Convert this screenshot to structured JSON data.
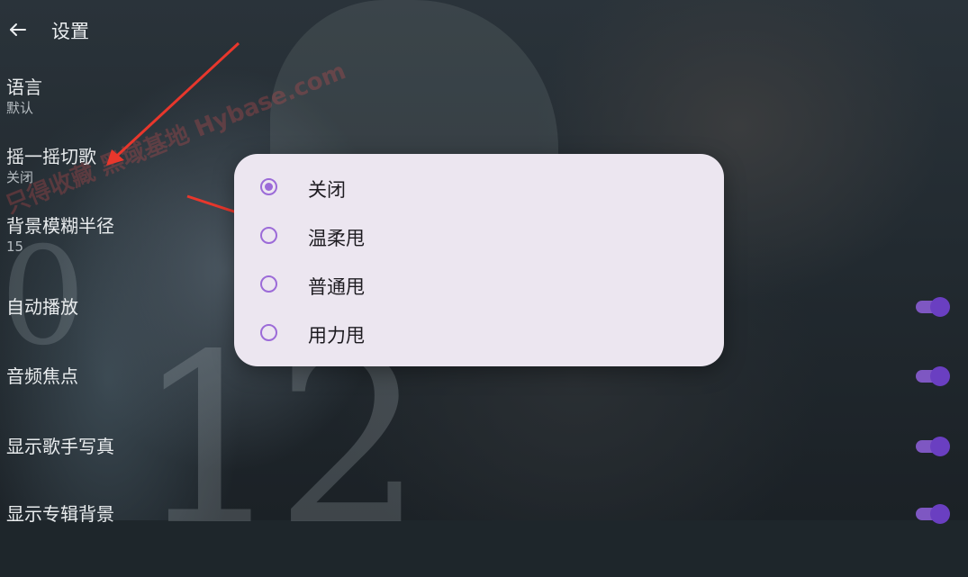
{
  "header": {
    "title": "设置"
  },
  "settings": [
    {
      "title": "语言",
      "value": "默认"
    },
    {
      "title": "摇一摇切歌",
      "value": "关闭"
    },
    {
      "title": "背景模糊半径",
      "value": "15"
    },
    {
      "title": "自动播放",
      "toggle": true
    },
    {
      "title": "音频焦点",
      "toggle": true
    },
    {
      "title": "显示歌手写真",
      "toggle": true
    },
    {
      "title": "显示专辑背景",
      "toggle": true
    }
  ],
  "dialog": {
    "options": [
      {
        "label": "关闭",
        "selected": true
      },
      {
        "label": "温柔甩",
        "selected": false
      },
      {
        "label": "普通甩",
        "selected": false
      },
      {
        "label": "用力甩",
        "selected": false
      }
    ]
  },
  "background": {
    "poster_number": "12",
    "poster_digit": "0"
  },
  "watermark": {
    "text": "只得收藏 黑域基地 Hybase.com"
  },
  "colors": {
    "accent": "#7e57c2",
    "dialog_bg": "#ece6f0",
    "annotation_arrow": "#e8372c"
  }
}
